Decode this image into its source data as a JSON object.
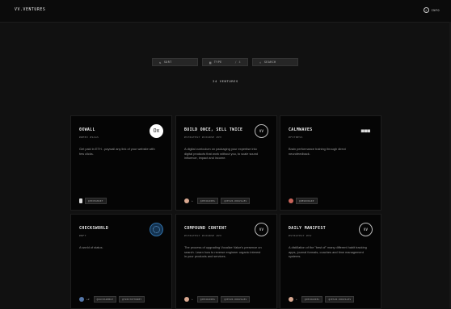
{
  "header": {
    "brand": "VV.VENTURES",
    "info_label": "INFO"
  },
  "controls": {
    "sort_label": "SORT",
    "type_label": "TYPE",
    "type_value": "/ 4",
    "search_placeholder": "SEARCH"
  },
  "count_label": "24 VENTURES",
  "cards": [
    {
      "title": "0XWALL",
      "tags": "#WEB3 #SAAS",
      "desc": "Get paid in ETH - paywall any link of your website with few clicks.",
      "logo": "0x",
      "logo_style": "white",
      "avatar": "doc",
      "more": "",
      "chips": [
        "@POCHANSKY"
      ]
    },
    {
      "title": "BUILD ONCE, SELL TWICE",
      "tags": "#STRATEGY #COURSE #VV",
      "desc": "A digital curriculum on packaging your expertise into digital products that work without you, to scale sound influence, impact and income.",
      "logo": "VV",
      "logo_style": "outline",
      "avatar": "warm",
      "more": "+",
      "chips": [
        "@JMCWADDEL",
        "@JESUS.DRUVALES"
      ]
    },
    {
      "title": "CALMWAVES",
      "tags": "#FITNESS",
      "desc": "Brain performance training through direct neurofeedback.",
      "logo": "■■■",
      "logo_style": "plain",
      "avatar": "red",
      "more": "",
      "chips": [
        "@NEUROWARP"
      ]
    },
    {
      "title": "CHECKSWORLD",
      "tags": "#NFT",
      "desc": "A world of status.",
      "logo": "",
      "logo_style": "blue",
      "avatar": "blue",
      "more": "+2",
      "chips": [
        "@ZACKSAMBLE",
        "@TWISTOFHONEY"
      ]
    },
    {
      "title": "COMPOUND CONTENT",
      "tags": "#STRATEGY #COURSE #VV",
      "desc": "The process of upgrading Vocalize Value's presence on search. Learn how to reverse engineer organic interest in your products and services.",
      "logo": "VV",
      "logo_style": "outline",
      "avatar": "warm",
      "more": "+",
      "chips": [
        "@JMCWADDEL",
        "@JESUS.DRUVALES"
      ]
    },
    {
      "title": "DAILY MANIFEST",
      "tags": "#STRATEGY #VV",
      "desc": "A distillation of the \"best of\" many different habit tracking apps, journal formats, coaches and time management systems.",
      "logo": "VV",
      "logo_style": "outline",
      "avatar": "warm",
      "more": "+",
      "chips": [
        "@JMCWADDEL",
        "@JESUS.DRUVALES"
      ]
    }
  ]
}
